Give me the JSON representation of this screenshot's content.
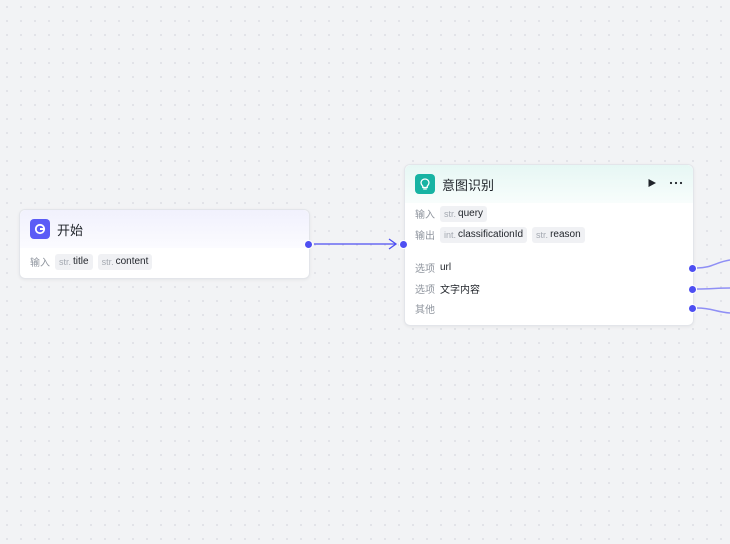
{
  "colors": {
    "accent": "#4e4ff2",
    "start_icon_bg": "#5b5cf6",
    "intent_icon_bg": "#17b3a3"
  },
  "start_node": {
    "title": "开始",
    "icon": "start-node-icon",
    "input_label": "输入",
    "inputs": [
      {
        "type": "str.",
        "name": "title"
      },
      {
        "type": "str.",
        "name": "content"
      }
    ]
  },
  "intent_node": {
    "title": "意图识别",
    "icon": "intent-bulb-icon",
    "run_icon": "play-icon",
    "more_icon": "more-icon",
    "input_label": "输入",
    "inputs": [
      {
        "type": "str.",
        "name": "query"
      }
    ],
    "output_label": "输出",
    "outputs": [
      {
        "type": "int.",
        "name": "classificationId"
      },
      {
        "type": "str.",
        "name": "reason"
      }
    ],
    "options": [
      {
        "label": "选项",
        "value": "url"
      },
      {
        "label": "选项",
        "value": "文字内容"
      },
      {
        "label": "其他",
        "value": ""
      }
    ]
  }
}
